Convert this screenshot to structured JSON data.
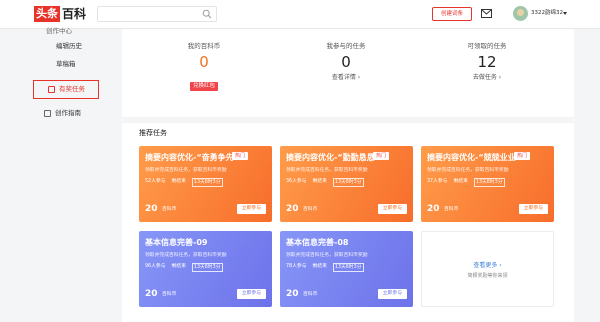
{
  "header": {
    "logo_red": "头条",
    "logo_black": "百科",
    "search_placeholder": "",
    "create_label": "创建词条",
    "username": "3322韵绵32"
  },
  "sidebar": {
    "partial_label": "创作中心",
    "items": [
      {
        "label": "编辑历史"
      },
      {
        "label": "草稿箱"
      },
      {
        "label": "有奖任务"
      },
      {
        "label": "创作指南"
      }
    ]
  },
  "stats": [
    {
      "label": "我的百科币",
      "value": "0",
      "action": "兑换红包"
    },
    {
      "label": "我参与的任务",
      "value": "0",
      "action": "查看详情 ›"
    },
    {
      "label": "可领取的任务",
      "value": "12",
      "action": "去做任务 ›"
    }
  ],
  "section_title": "推荐任务",
  "cards": [
    {
      "title": "摘要内容优化-“奋勇争先...",
      "hot": "热门",
      "desc": "领取并完成百科任务，获取百科币奖励",
      "participants": "52人参与",
      "deadline_label": "剩结束",
      "timer": "13天8时3分",
      "amount": "20",
      "unit": "百科币",
      "join": "立即参与"
    },
    {
      "title": "摘要内容优化-“勤勤恳恳...",
      "hot": "热门",
      "desc": "领取并完成百科任务，获取百科币奖励",
      "participants": "36人参与",
      "deadline_label": "剩结束",
      "timer": "13天8时3分",
      "amount": "20",
      "unit": "百科币",
      "join": "立即参与"
    },
    {
      "title": "摘要内容优化-“兢兢业业...",
      "hot": "热门",
      "desc": "领取并完成百科任务，获取百科币奖励",
      "participants": "37人参与",
      "deadline_label": "剩结束",
      "timer": "13天8时3分",
      "amount": "20",
      "unit": "百科币",
      "join": "立即参与"
    },
    {
      "title": "基本信息完善-09",
      "hot": "",
      "desc": "领取并完成百科任务，获取百科币奖励",
      "participants": "96人参与",
      "deadline_label": "剩结束",
      "timer": "13天8时3分",
      "amount": "20",
      "unit": "百科币",
      "join": "立即参与"
    },
    {
      "title": "基本信息完善-08",
      "hot": "",
      "desc": "领取并完成百科任务，获取百科币奖励",
      "participants": "78人参与",
      "deadline_label": "剩结束",
      "timer": "13天8时3分",
      "amount": "20",
      "unit": "百科币",
      "join": "立即参与"
    }
  ],
  "more_card": {
    "title": "查看更多 ›",
    "subtitle": "简颖奖励等你来领"
  },
  "colors": {
    "brand_red": "#e7332a",
    "orange": "#f76d2b",
    "purple": "#6d72ea",
    "link": "#3b7fd6"
  }
}
